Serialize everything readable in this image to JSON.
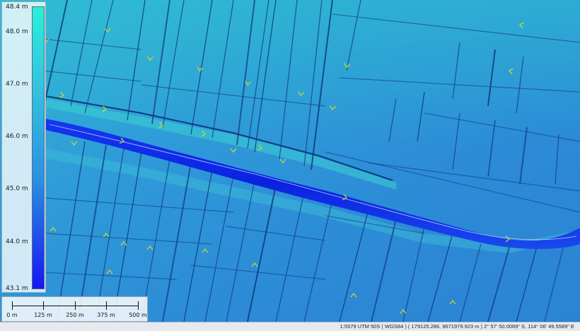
{
  "legend": {
    "title": "",
    "labels": [
      "48.4 m",
      "48.0 m",
      "47.0 m",
      "46.0 m",
      "45.0 m",
      "44.0 m",
      "43.1 m"
    ],
    "values": [
      48.4,
      48.0,
      47.0,
      46.0,
      45.0,
      44.0,
      43.1
    ],
    "min": 43.1,
    "max": 48.4,
    "color_low": "#1515f5",
    "color_high": "#2af0d8"
  },
  "scale_bar": {
    "labels": [
      "0 m",
      "125 m",
      "250 m",
      "375 m",
      "500 m"
    ]
  },
  "status_bar": {
    "text": "1:5579  UTM 50S ( WGS84 ) ( 179125.286, 9671979.923 m )  2° 57' 50.0069\" S, 114° 06' 49.5589\" E"
  },
  "colors": {
    "terrain_base": "#2f8fd6",
    "terrain_high": "#3fc8d8",
    "canal": "#0a2ee6",
    "flow_arrow": "#c8d832"
  },
  "icons": [
    "flow-arrow-icon"
  ]
}
